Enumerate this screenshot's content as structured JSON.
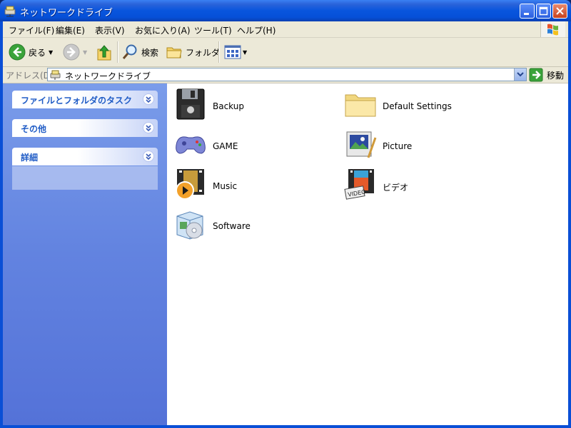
{
  "window": {
    "title": "ネットワークドライブ"
  },
  "menu": [
    "ファイル(F)",
    "編集(E)",
    "表示(V)",
    "お気に入り(A)",
    "ツール(T)",
    "ヘルプ(H)"
  ],
  "toolbar": {
    "back": "戻る",
    "search": "検索",
    "folders": "フォルダ"
  },
  "address": {
    "label": "アドレス(D)",
    "value": "ネットワークドライブ",
    "go": "移動"
  },
  "taskpane": {
    "groups": [
      "ファイルとフォルダのタスク",
      "その他",
      "詳細"
    ]
  },
  "items": [
    {
      "name": "Backup",
      "icon": "floppy-icon"
    },
    {
      "name": "Default Settings",
      "icon": "folder-icon"
    },
    {
      "name": "GAME",
      "icon": "gamepad-icon"
    },
    {
      "name": "Picture",
      "icon": "picture-icon"
    },
    {
      "name": "Music",
      "icon": "music-icon"
    },
    {
      "name": "ビデオ",
      "icon": "video-icon"
    },
    {
      "name": "Software",
      "icon": "software-box-icon"
    }
  ]
}
